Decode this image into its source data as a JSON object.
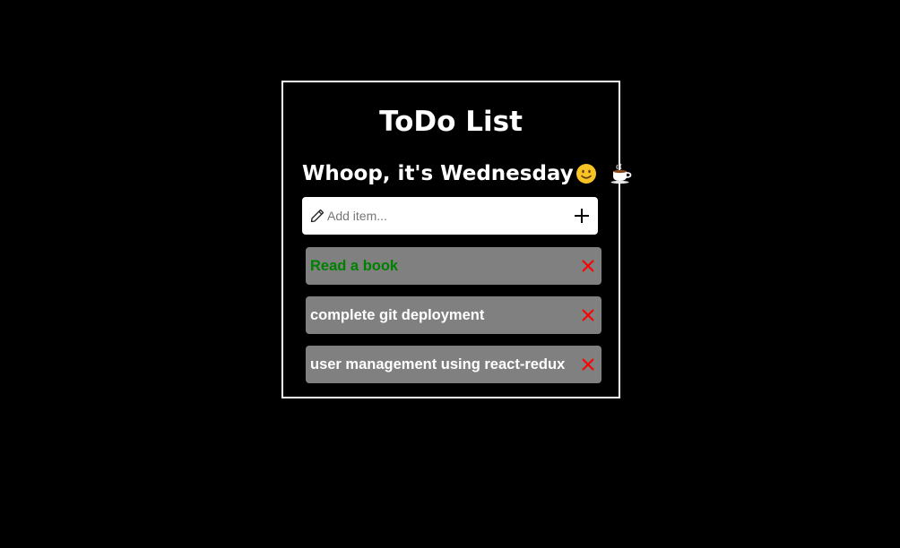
{
  "header": {
    "title": "ToDo List",
    "greeting": "Whoop, it's Wednesday"
  },
  "icons": {
    "greeting_emoji": "smiley-face-icon",
    "drink_emoji": "coffee-cup-icon",
    "input_icon": "pencil-icon",
    "add_icon": "plus-icon",
    "delete_icon": "close-x-icon"
  },
  "add_item": {
    "placeholder": "Add item...",
    "value": ""
  },
  "todos": [
    {
      "label": "Read a book",
      "completed": true
    },
    {
      "label": "complete git deployment",
      "completed": false
    },
    {
      "label": "user management using react-redux",
      "completed": false
    }
  ],
  "colors": {
    "background": "#000000",
    "card_border": "#ffffff",
    "item_background": "#808080",
    "completed_text": "#008000",
    "pending_text": "#ffffff",
    "delete_icon": "#ff0000"
  }
}
